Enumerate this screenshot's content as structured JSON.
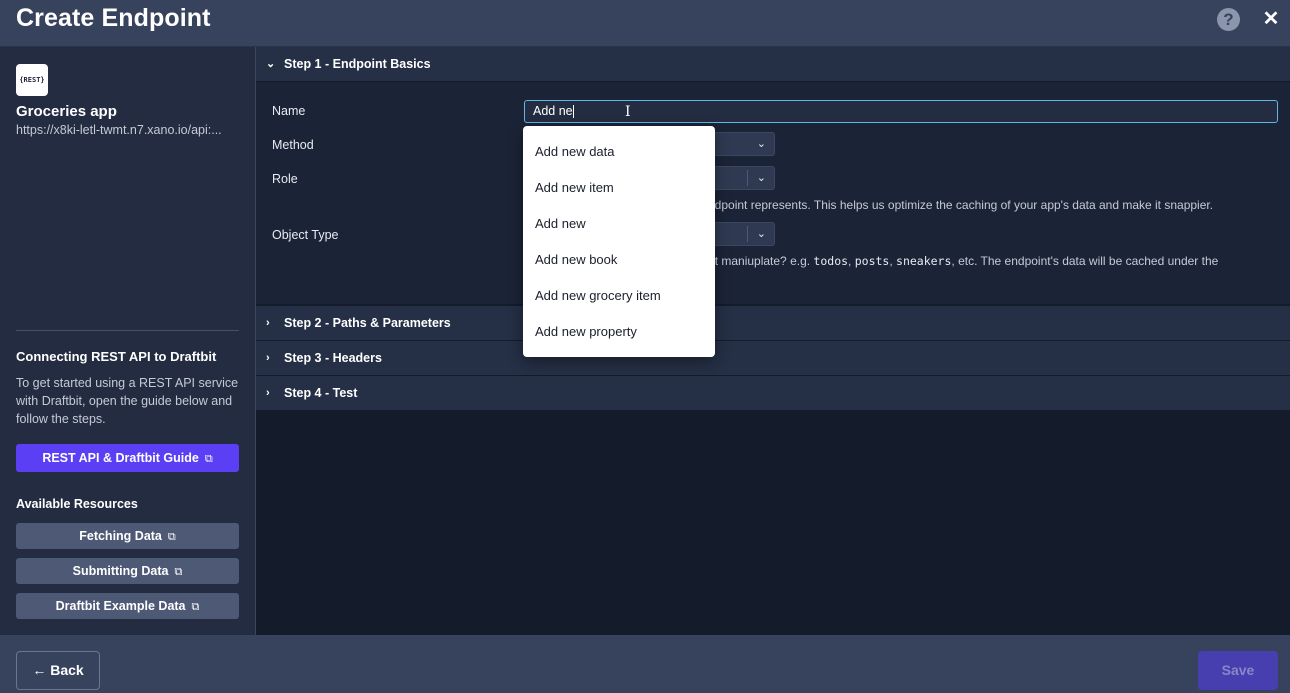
{
  "window": {
    "title": "Create Endpoint",
    "help_icon": "help-icon",
    "help_glyph": "?",
    "close_icon": "close-icon",
    "close_glyph": "✕"
  },
  "sidebar": {
    "logo_icon": "rest-logo-icon",
    "logo_text": "{REST}",
    "app_name": "Groceries app",
    "app_url": "https://x8ki-letl-twmt.n7.xano.io/api:...",
    "guide_title": "Connecting REST API to Draftbit",
    "guide_description": "To get started using a REST API service with Draftbit, open the guide below and follow the steps.",
    "guide_button": "REST API & Draftbit Guide",
    "resources_title": "Available Resources",
    "resources": [
      {
        "label": "Fetching Data"
      },
      {
        "label": "Submitting Data"
      },
      {
        "label": "Draftbit Example Data"
      }
    ],
    "external_icon": "external-link-icon",
    "external_glyph": "⧉"
  },
  "steps": [
    {
      "label": "Step 1 - Endpoint Basics",
      "expanded": true,
      "chevron": "⌄"
    },
    {
      "label": "Step 2 - Paths & Parameters",
      "expanded": false,
      "chevron": "›"
    },
    {
      "label": "Step 3 - Headers",
      "expanded": false,
      "chevron": "›"
    },
    {
      "label": "Step 4 - Test",
      "expanded": false,
      "chevron": "›"
    }
  ],
  "form": {
    "name_label": "Name",
    "name_value": "Add ne",
    "method_label": "Method",
    "role_label": "Role",
    "role_help": "s endpoint represents. This helps us optimize the caching of your app's data and make it snappier.",
    "object_type_label": "Object Type",
    "object_help_prefix": "point maniuplate? e.g. ",
    "object_examples": [
      "todos",
      "posts",
      "sneakers"
    ],
    "object_help_suffix": ", etc. The endpoint's data will be cached under the",
    "select_arrow": "⌄"
  },
  "autocomplete": {
    "options": [
      "Add new data",
      "Add new item",
      "Add new",
      "Add new book",
      "Add new grocery item",
      "Add new property"
    ]
  },
  "footer": {
    "back_label": "← Back",
    "save_label": "Save",
    "save_enabled": false
  },
  "colors": {
    "accent": "#5a3ff5",
    "input_focus": "#5fb7e8",
    "save_disabled": "#473eb0"
  }
}
